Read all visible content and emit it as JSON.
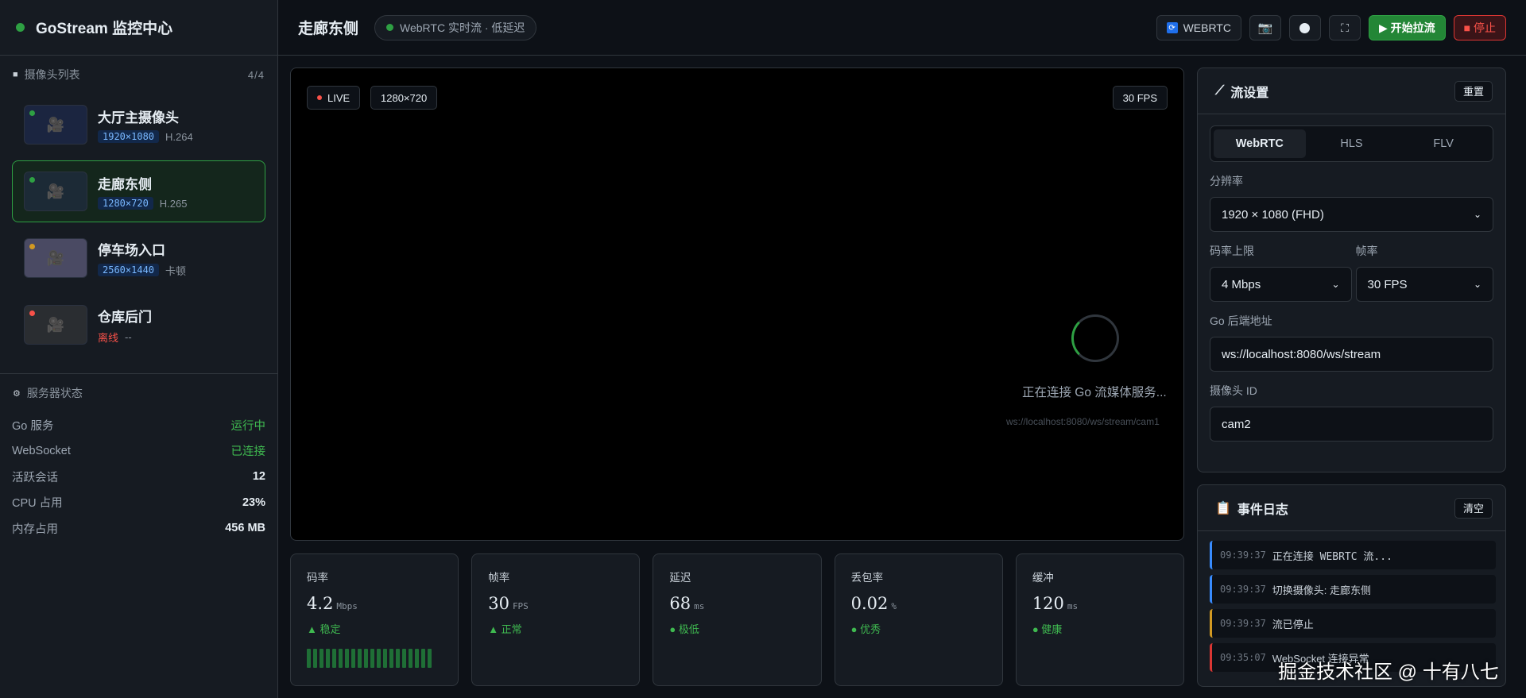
{
  "app": {
    "title": "GoStream 监控中心"
  },
  "sidebar": {
    "cameras_header": {
      "icon": "camera-icon",
      "label": "摄像头列表",
      "count": "4/4"
    },
    "cameras": [
      {
        "name": "大厅主摄像头",
        "res": "1920×1080",
        "meta": "H.264",
        "status_color": "#2ea043",
        "thumb_color": "#1b2540"
      },
      {
        "name": "走廊东侧",
        "res": "1280×720",
        "meta": "H.265",
        "status_color": "#2ea043",
        "thumb_color": "#1c2a36"
      },
      {
        "name": "停车场入口",
        "res": "2560×1440",
        "meta": "卡顿",
        "status_color": "#d29922",
        "thumb_color": "#4a4a63"
      },
      {
        "name": "仓库后门",
        "res": "离线",
        "meta": "--",
        "status_color": "#f85149",
        "thumb_color": "#2a2d31"
      }
    ],
    "server_header": {
      "icon": "gear-icon",
      "label": "服务器状态"
    },
    "server_status": [
      {
        "key": "Go 服务",
        "value": "运行中"
      },
      {
        "key": "WebSocket",
        "value": "已连接"
      },
      {
        "key": "活跃会话",
        "value": "12"
      },
      {
        "key": "CPU 占用",
        "value": "23%"
      },
      {
        "key": "内存占用",
        "value": "456 MB"
      }
    ]
  },
  "header": {
    "title": "走廊东侧",
    "stream_pill": "WebRTC 实时流 · 低延迟",
    "protocol_button": "WEBRTC",
    "start_button": "▶ 开始拉流",
    "stop_button": "■ 停止"
  },
  "video": {
    "live_label": "LIVE",
    "resolution": "1280×720",
    "fps": "30 FPS",
    "loading_text": "正在连接 Go 流媒体服务...",
    "ws_url": "ws://localhost:8080/ws/stream/cam1"
  },
  "metrics": [
    {
      "label": "码率",
      "value": "4.2",
      "unit": "Mbps",
      "status": "▲ 稳定"
    },
    {
      "label": "帧率",
      "value": "30",
      "unit": "FPS",
      "status": "▲ 正常"
    },
    {
      "label": "延迟",
      "value": "68",
      "unit": "ms",
      "status": "● 极低"
    },
    {
      "label": "丢包率",
      "value": "0.02",
      "unit": "%",
      "status": "● 优秀"
    },
    {
      "label": "缓冲",
      "value": "120",
      "unit": "ms",
      "status": "● 健康"
    }
  ],
  "stream_settings": {
    "title": "流设置",
    "reset": "重置",
    "tabs": [
      "WebRTC",
      "HLS",
      "FLV"
    ],
    "resolution_label": "分辨率",
    "resolution_value": "1920 × 1080 (FHD)",
    "bitrate_label": "码率上限",
    "bitrate_value": "4 Mbps",
    "framerate_label": "帧率",
    "framerate_value": "30 FPS",
    "backend_label": "Go 后端地址",
    "backend_value": "ws://localhost:8080/ws/stream",
    "camera_id_label": "摄像头 ID",
    "camera_id_value": "cam2"
  },
  "event_log": {
    "title": "事件日志",
    "clear": "清空",
    "entries": [
      {
        "time": "09:39:37",
        "message": "正在连接 WEBRTC 流...",
        "color": "#388bfd"
      },
      {
        "time": "09:39:37",
        "message": "切换摄像头: 走廊东侧",
        "color": "#388bfd"
      },
      {
        "time": "09:39:37",
        "message": "流已停止",
        "color": "#d29922"
      },
      {
        "time": "09:35:07",
        "message": "WebSocket 连接异常",
        "color": "#da3633"
      }
    ]
  },
  "watermark": "掘金技术社区 @ 十有八七",
  "colors": {
    "accent": "#2ea043",
    "danger": "#f85149",
    "bg": "#0d1117",
    "panel": "#161b22"
  }
}
